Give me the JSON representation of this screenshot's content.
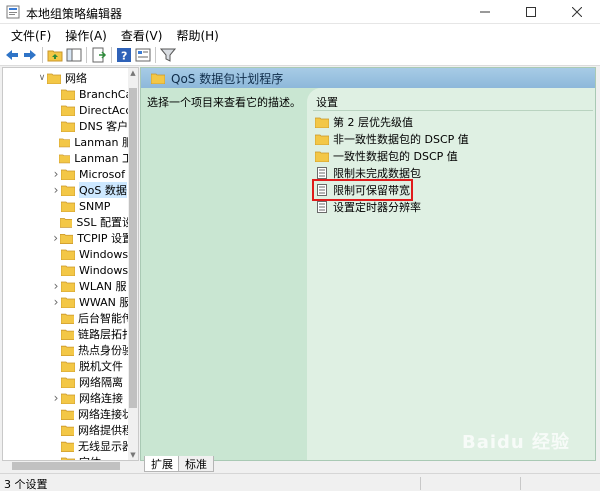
{
  "window": {
    "title": "本地组策略编辑器"
  },
  "menubar": {
    "items": [
      {
        "label": "文件(F)"
      },
      {
        "label": "操作(A)"
      },
      {
        "label": "查看(V)"
      },
      {
        "label": "帮助(H)"
      }
    ]
  },
  "tree": {
    "items": [
      {
        "label": "网络",
        "expanded": true,
        "has_children": true,
        "selected": false,
        "indent": 1
      },
      {
        "label": "BranchCa",
        "has_children": false,
        "selected": false,
        "indent": 2
      },
      {
        "label": "DirectAcc",
        "has_children": false,
        "selected": false,
        "indent": 2
      },
      {
        "label": "DNS 客户",
        "has_children": false,
        "selected": false,
        "indent": 2
      },
      {
        "label": "Lanman 服",
        "has_children": false,
        "selected": false,
        "indent": 2
      },
      {
        "label": "Lanman 工",
        "has_children": false,
        "selected": false,
        "indent": 2
      },
      {
        "label": "Microsof",
        "has_children": true,
        "selected": false,
        "indent": 2
      },
      {
        "label": "QoS 数据",
        "has_children": true,
        "selected": true,
        "indent": 2
      },
      {
        "label": "SNMP",
        "has_children": false,
        "selected": false,
        "indent": 2
      },
      {
        "label": "SSL 配置设",
        "has_children": false,
        "selected": false,
        "indent": 2
      },
      {
        "label": "TCPIP 设置",
        "has_children": true,
        "selected": false,
        "indent": 2
      },
      {
        "label": "Windows",
        "has_children": false,
        "selected": false,
        "indent": 2
      },
      {
        "label": "Windows",
        "has_children": false,
        "selected": false,
        "indent": 2
      },
      {
        "label": "WLAN 服",
        "has_children": true,
        "selected": false,
        "indent": 2
      },
      {
        "label": "WWAN 服",
        "has_children": true,
        "selected": false,
        "indent": 2
      },
      {
        "label": "后台智能传",
        "has_children": false,
        "selected": false,
        "indent": 2
      },
      {
        "label": "链路层拓扑",
        "has_children": false,
        "selected": false,
        "indent": 2
      },
      {
        "label": "热点身份验",
        "has_children": false,
        "selected": false,
        "indent": 2
      },
      {
        "label": "脱机文件",
        "has_children": false,
        "selected": false,
        "indent": 2
      },
      {
        "label": "网络隔离",
        "has_children": false,
        "selected": false,
        "indent": 2
      },
      {
        "label": "网络连接",
        "has_children": true,
        "selected": false,
        "indent": 2
      },
      {
        "label": "网络连接状",
        "has_children": false,
        "selected": false,
        "indent": 2
      },
      {
        "label": "网络提供程",
        "has_children": false,
        "selected": false,
        "indent": 2
      },
      {
        "label": "无线显示器",
        "has_children": false,
        "selected": false,
        "indent": 2
      },
      {
        "label": "字体",
        "has_children": false,
        "selected": false,
        "indent": 2
      }
    ]
  },
  "detail": {
    "header_title": "QoS 数据包计划程序",
    "description": "选择一个项目来查看它的描述。",
    "column_header": "设置",
    "rows": [
      {
        "label": "第 2 层优先级值",
        "kind": "folder",
        "highlight": false
      },
      {
        "label": "非一致性数据包的 DSCP 值",
        "kind": "folder",
        "highlight": false
      },
      {
        "label": "一致性数据包的 DSCP 值",
        "kind": "folder",
        "highlight": false
      },
      {
        "label": "限制未完成数据包",
        "kind": "policy",
        "highlight": false
      },
      {
        "label": "限制可保留带宽",
        "kind": "policy",
        "highlight": true
      },
      {
        "label": "设置定时器分辨率",
        "kind": "policy",
        "highlight": false
      }
    ]
  },
  "tabs": [
    {
      "label": "扩展",
      "active": true
    },
    {
      "label": "标准",
      "active": false
    }
  ],
  "statusbar": {
    "text": "3 个设置"
  },
  "watermark": {
    "text": "Baidu 经验"
  },
  "colors": {
    "folder": "#f3c746",
    "header_blue": "#9cc3e2",
    "detail_green": "#c9e6d2",
    "highlight_red": "#e01b1b"
  }
}
